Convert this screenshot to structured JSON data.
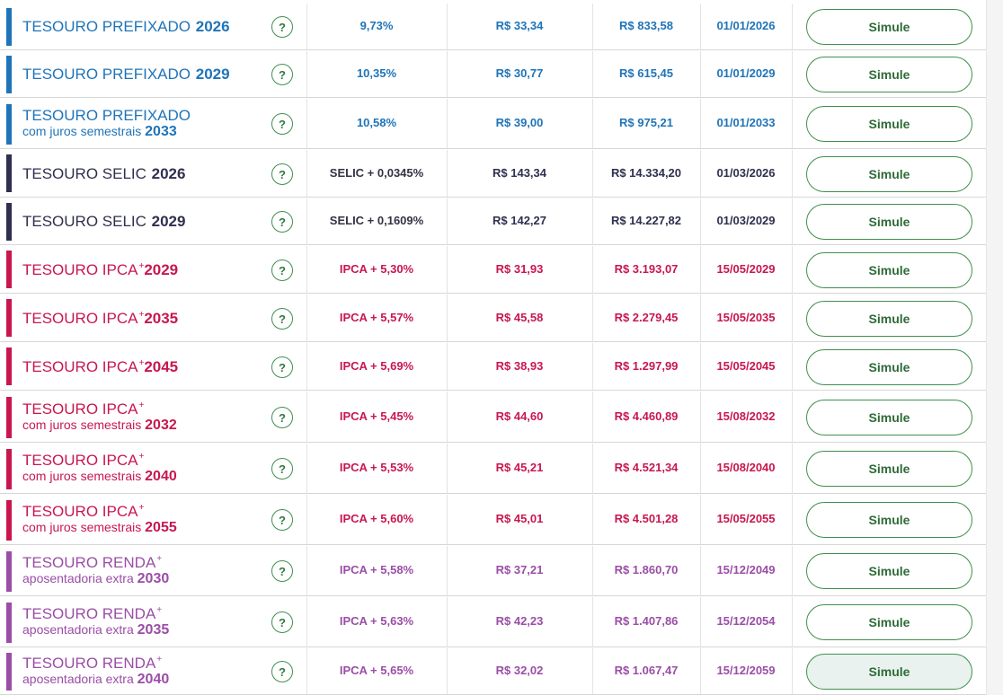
{
  "simule_label": "Simule",
  "help_symbol": "?",
  "titles": [
    {
      "main": "TESOURO PREFIXADO ",
      "year": "2026",
      "sup": "",
      "sub": "",
      "sub_year": "",
      "color": "#1f74b8"
    },
    {
      "main": "TESOURO PREFIXADO ",
      "year": "2029",
      "sup": "",
      "sub": "",
      "sub_year": "",
      "color": "#1f74b8"
    },
    {
      "main": "TESOURO PREFIXADO",
      "year": "",
      "sup": "",
      "sub": "com juros semestrais ",
      "sub_year": "2033",
      "color": "#1f74b8"
    },
    {
      "main": "TESOURO SELIC ",
      "year": "2026",
      "sup": "",
      "sub": "",
      "sub_year": "",
      "color": "#2f2f4f"
    },
    {
      "main": "TESOURO SELIC ",
      "year": "2029",
      "sup": "",
      "sub": "",
      "sub_year": "",
      "color": "#2f2f4f"
    },
    {
      "main": "TESOURO IPCA",
      "year": "2029",
      "sup": "+",
      "sub": "",
      "sub_year": "",
      "color": "#c8174f"
    },
    {
      "main": "TESOURO IPCA",
      "year": "2035",
      "sup": "+",
      "sub": "",
      "sub_year": "",
      "color": "#c8174f"
    },
    {
      "main": "TESOURO IPCA",
      "year": "2045",
      "sup": "+",
      "sub": "",
      "sub_year": "",
      "color": "#c8174f"
    },
    {
      "main": "TESOURO IPCA",
      "year": "",
      "sup": "+",
      "sub": "com juros semestrais ",
      "sub_year": "2032",
      "color": "#c8174f"
    },
    {
      "main": "TESOURO IPCA",
      "year": "",
      "sup": "+",
      "sub": "com juros semestrais ",
      "sub_year": "2040",
      "color": "#c8174f"
    },
    {
      "main": "TESOURO IPCA",
      "year": "",
      "sup": "+",
      "sub": "com juros semestrais ",
      "sub_year": "2055",
      "color": "#c8174f"
    },
    {
      "main": "TESOURO RENDA",
      "year": "",
      "sup": "+",
      "sub": "aposentadoria extra ",
      "sub_year": "2030",
      "color": "#9a4ea6"
    },
    {
      "main": "TESOURO RENDA",
      "year": "",
      "sup": "+",
      "sub": "aposentadoria extra ",
      "sub_year": "2035",
      "color": "#9a4ea6"
    },
    {
      "main": "TESOURO RENDA",
      "year": "",
      "sup": "+",
      "sub": "aposentadoria extra ",
      "sub_year": "2040",
      "color": "#9a4ea6"
    }
  ],
  "values": [
    {
      "rate": "9,73%",
      "min": "R$ 33,34",
      "unit": "R$ 833,58",
      "date": "01/01/2026"
    },
    {
      "rate": "10,35%",
      "min": "R$ 30,77",
      "unit": "R$ 615,45",
      "date": "01/01/2029"
    },
    {
      "rate": "10,58%",
      "min": "R$ 39,00",
      "unit": "R$ 975,21",
      "date": "01/01/2033"
    },
    {
      "rate": "SELIC + 0,0345%",
      "min": "R$ 143,34",
      "unit": "R$ 14.334,20",
      "date": "01/03/2026"
    },
    {
      "rate": "SELIC + 0,1609%",
      "min": "R$ 142,27",
      "unit": "R$ 14.227,82",
      "date": "01/03/2029"
    },
    {
      "rate": "IPCA + 5,30%",
      "min": "R$ 31,93",
      "unit": "R$ 3.193,07",
      "date": "15/05/2029"
    },
    {
      "rate": "IPCA + 5,57%",
      "min": "R$ 45,58",
      "unit": "R$ 2.279,45",
      "date": "15/05/2035"
    },
    {
      "rate": "IPCA + 5,69%",
      "min": "R$ 38,93",
      "unit": "R$ 1.297,99",
      "date": "15/05/2045"
    },
    {
      "rate": "IPCA + 5,45%",
      "min": "R$ 44,60",
      "unit": "R$ 4.460,89",
      "date": "15/08/2032"
    },
    {
      "rate": "IPCA + 5,53%",
      "min": "R$ 45,21",
      "unit": "R$ 4.521,34",
      "date": "15/08/2040"
    },
    {
      "rate": "IPCA + 5,60%",
      "min": "R$ 45,01",
      "unit": "R$ 4.501,28",
      "date": "15/05/2055"
    },
    {
      "rate": "IPCA + 5,58%",
      "min": "R$ 37,21",
      "unit": "R$ 1.860,70",
      "date": "15/12/2049"
    },
    {
      "rate": "IPCA + 5,63%",
      "min": "R$ 42,23",
      "unit": "R$ 1.407,86",
      "date": "15/12/2054"
    },
    {
      "rate": "IPCA + 5,65%",
      "min": "R$ 32,02",
      "unit": "R$ 1.067,47",
      "date": "15/12/2059"
    }
  ]
}
